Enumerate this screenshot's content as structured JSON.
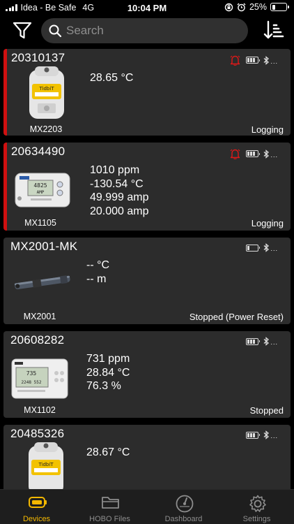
{
  "status_bar": {
    "carrier": "Idea - Be Safe",
    "network": "4G",
    "time": "10:04 PM",
    "battery_percent": "25%",
    "battery_level": 0.25
  },
  "toolbar": {
    "search_placeholder": "Search"
  },
  "devices": [
    {
      "id": "20310137",
      "model": "MX2203",
      "readings": [
        "28.65 °C"
      ],
      "status": "Logging",
      "alarm": true,
      "battery_bars": 3,
      "image": "tidbit-logger"
    },
    {
      "id": "20634490",
      "model": "MX1105",
      "readings": [
        "1010 ppm",
        "-130.54 °C",
        "49.999 amp",
        "20.000 amp"
      ],
      "status": "Logging",
      "alarm": true,
      "battery_bars": 3,
      "image": "mx1105-logger"
    },
    {
      "id": "MX2001-MK",
      "model": "MX2001",
      "readings": [
        "-- °C",
        "-- m"
      ],
      "status": "Stopped (Power Reset)",
      "alarm": false,
      "battery_bars": 1,
      "image": "water-level-logger"
    },
    {
      "id": "20608282",
      "model": "MX1102",
      "readings": [
        "731 ppm",
        "28.84 °C",
        "76.3 %"
      ],
      "status": "Stopped",
      "alarm": false,
      "battery_bars": 3,
      "image": "co2-logger"
    },
    {
      "id": "20485326",
      "model": "",
      "readings": [
        "28.67 °C"
      ],
      "status": "",
      "alarm": false,
      "battery_bars": 3,
      "image": "tidbit-logger"
    }
  ],
  "tabs": [
    {
      "label": "Devices",
      "icon": "devices-icon",
      "active": true
    },
    {
      "label": "HOBO Files",
      "icon": "folder-icon",
      "active": false
    },
    {
      "label": "Dashboard",
      "icon": "gauge-icon",
      "active": false
    },
    {
      "label": "Settings",
      "icon": "gear-icon",
      "active": false
    }
  ],
  "colors": {
    "background": "#000000",
    "card": "#2c2c2c",
    "alarm": "#d01010",
    "active_tab": "#f4b800",
    "inactive_tab": "#8d8d8d"
  }
}
